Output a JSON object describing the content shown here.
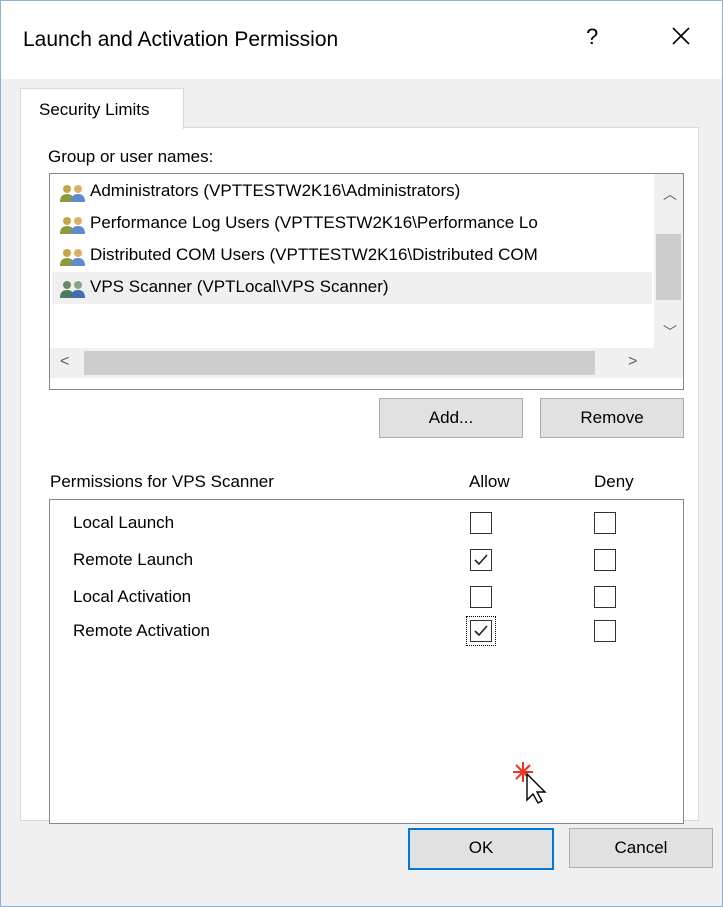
{
  "window": {
    "title": "Launch and Activation Permission",
    "help_label": "?"
  },
  "tabs": [
    {
      "label": "Security Limits"
    }
  ],
  "users": {
    "label": "Group or user names:",
    "items": [
      {
        "name": "Administrators (VPTTESTW2K16\\Administrators)",
        "selected": false
      },
      {
        "name": "Performance Log Users (VPTTESTW2K16\\Performance Lo",
        "selected": false
      },
      {
        "name": "Distributed COM Users (VPTTESTW2K16\\Distributed COM",
        "selected": false
      },
      {
        "name": "VPS Scanner (VPTLocal\\VPS Scanner)",
        "selected": true
      }
    ]
  },
  "buttons": {
    "add": "Add...",
    "remove": "Remove",
    "ok": "OK",
    "cancel": "Cancel"
  },
  "permissions": {
    "title": "Permissions for VPS Scanner",
    "allow_header": "Allow",
    "deny_header": "Deny",
    "rows": [
      {
        "label": "Local Launch",
        "allow": false,
        "deny": false
      },
      {
        "label": "Remote Launch",
        "allow": true,
        "deny": false
      },
      {
        "label": "Local Activation",
        "allow": false,
        "deny": false
      },
      {
        "label": "Remote Activation",
        "allow": true,
        "deny": false,
        "focused": true
      }
    ]
  },
  "colors": {
    "accent": "#0078d7",
    "window_border": "#8fb0cf",
    "face": "#f0f0f0",
    "button": "#e1e1e1"
  }
}
